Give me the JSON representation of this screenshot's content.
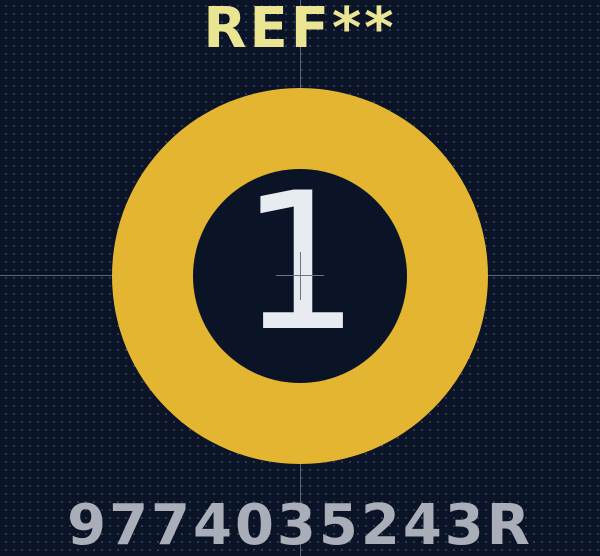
{
  "footprint": {
    "reference": "REF**",
    "value": "9774035243R",
    "pad_number": "1"
  },
  "colors": {
    "background": "#0b1427",
    "pad_copper": "#e3b530",
    "reference_text": "#e9e592",
    "value_text": "#a9aeb8",
    "pad_number_text": "#e8ebf0",
    "crosshair": "#5d6578"
  }
}
